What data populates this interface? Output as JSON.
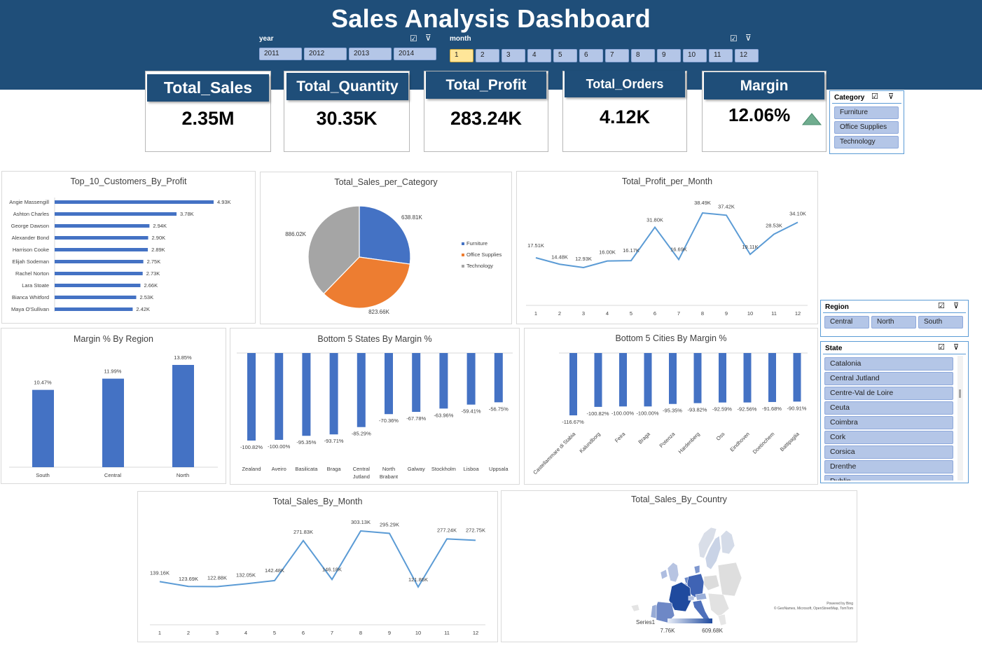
{
  "dashboard": {
    "title": "Sales Analysis Dashboard"
  },
  "slicers": {
    "year": {
      "label": "year",
      "items": [
        "2011",
        "2012",
        "2013",
        "2014"
      ]
    },
    "month": {
      "label": "month",
      "items": [
        "1",
        "2",
        "3",
        "4",
        "5",
        "6",
        "7",
        "8",
        "9",
        "10",
        "11",
        "12"
      ],
      "selected": "1"
    },
    "category": {
      "label": "Category",
      "items": [
        "Furniture",
        "Office Supplies",
        "Technology"
      ]
    },
    "region": {
      "label": "Region",
      "items": [
        "Central",
        "North",
        "South"
      ]
    },
    "state": {
      "label": "State",
      "items": [
        "Catalonia",
        "Central Jutland",
        "Centre-Val de Loire",
        "Ceuta",
        "Coimbra",
        "Cork",
        "Corsica",
        "Drenthe",
        "Dublin"
      ]
    }
  },
  "kpis": {
    "total_sales": {
      "label": "Total_Sales",
      "value": "2.35M"
    },
    "total_quantity": {
      "label": "Total_Quantity",
      "value": "30.35K"
    },
    "total_profit": {
      "label": "Total_Profit",
      "value": "283.24K"
    },
    "total_orders": {
      "label": "Total_Orders",
      "value": "4.12K"
    },
    "margin": {
      "label": "Margin",
      "value": "12.06%",
      "trend_icon": "up-triangle-icon",
      "trend_color": "#70ad8f"
    }
  },
  "colors": {
    "header": "#1f4e79",
    "bar": "#4472c4",
    "line": "#5b9bd5",
    "pie_furniture": "#4472c4",
    "pie_office": "#ed7d31",
    "pie_technology": "#a5a5a5",
    "slicer_item": "#b4c6e7",
    "slicer_selected": "#ffe699"
  },
  "map": {
    "title": "Total_Sales_By_Country",
    "legend_series": "Series1",
    "legend_min": "7.76K",
    "legend_max": "609.68K",
    "credit_line1": "Powered by Bing",
    "credit_line2": "© GeoNames, Microsoft, OpenStreetMap, TomTom"
  },
  "chart_data": [
    {
      "id": "top_customers",
      "type": "bar",
      "orientation": "horizontal",
      "title": "Top_10_Customers_By_Profit",
      "categories": [
        "Angie Massengill",
        "Ashton Charles",
        "George Dawson",
        "Alexander Bond",
        "Harrison Cooke",
        "Elijah Sodeman",
        "Rachel Norton",
        "Lara Stoate",
        "Bianca Whitford",
        "Maya O'Sullivan"
      ],
      "values": [
        4.93,
        3.78,
        2.94,
        2.9,
        2.89,
        2.75,
        2.73,
        2.66,
        2.53,
        2.42
      ],
      "labels": [
        "4.93K",
        "3.78K",
        "2.94K",
        "2.90K",
        "2.89K",
        "2.75K",
        "2.73K",
        "2.66K",
        "2.53K",
        "2.42K"
      ],
      "unit": "K"
    },
    {
      "id": "sales_per_category",
      "type": "pie",
      "title": "Total_Sales_per_Category",
      "categories": [
        "Furniture",
        "Office Supplies",
        "Technology"
      ],
      "values": [
        638.81,
        823.66,
        886.02
      ],
      "labels": [
        "638.81K",
        "823.66K",
        "886.02K"
      ],
      "legend": "right"
    },
    {
      "id": "profit_per_month",
      "type": "line",
      "title": "Total_Profit_per_Month",
      "x": [
        "1",
        "2",
        "3",
        "4",
        "5",
        "6",
        "7",
        "8",
        "9",
        "10",
        "11",
        "12"
      ],
      "values": [
        17.51,
        14.48,
        12.93,
        16.0,
        16.17,
        31.8,
        16.69,
        38.49,
        37.42,
        19.11,
        28.53,
        34.1
      ],
      "labels": [
        "17.51K",
        "14.48K",
        "12.93K",
        "16.00K",
        "16.17K",
        "31.80K",
        "16.69K",
        "38.49K",
        "37.42K",
        "19.11K",
        "28.53K",
        "34.10K"
      ]
    },
    {
      "id": "margin_by_region",
      "type": "bar",
      "title": "Margin % By Region",
      "categories": [
        "South",
        "Central",
        "North"
      ],
      "values": [
        10.47,
        11.99,
        13.85
      ],
      "labels": [
        "10.47%",
        "11.99%",
        "13.85%"
      ]
    },
    {
      "id": "bottom_states",
      "type": "bar",
      "title": "Bottom 5 States By Margin %",
      "categories": [
        "Zealand",
        "Aveiro",
        "Basilicata",
        "Braga",
        "Central Jutland",
        "North Brabant",
        "Galway",
        "Stockholm",
        "Lisboa",
        "Uppsala"
      ],
      "values": [
        -100.82,
        -100.0,
        -95.35,
        -93.71,
        -85.29,
        -70.36,
        -67.78,
        -63.96,
        -59.41,
        -56.75
      ],
      "labels": [
        "-100.82%",
        "-100.00%",
        "-95.35%",
        "-93.71%",
        "-85.29%",
        "-70.36%",
        "-67.78%",
        "-63.96%",
        "-59.41%",
        "-56.75%"
      ]
    },
    {
      "id": "bottom_cities",
      "type": "bar",
      "title": "Bottom 5 Cities By Margin %",
      "categories": [
        "Castellammare di Stabia",
        "Kalundborg",
        "Feira",
        "Braga",
        "Potenza",
        "Hardenberg",
        "Oss",
        "Eindhoven",
        "Doetinchem",
        "Battipaglia"
      ],
      "values": [
        -116.67,
        -100.82,
        -100.0,
        -100.0,
        -95.35,
        -93.82,
        -92.59,
        -92.56,
        -91.68,
        -90.91
      ],
      "labels": [
        "-116.67%",
        "-100.82%",
        "-100.00%",
        "-100.00%",
        "-95.35%",
        "-93.82%",
        "-92.59%",
        "-92.56%",
        "-91.68%",
        "-90.91%"
      ]
    },
    {
      "id": "sales_by_month",
      "type": "line",
      "title": "Total_Sales_By_Month",
      "x": [
        "1",
        "2",
        "3",
        "4",
        "5",
        "6",
        "7",
        "8",
        "9",
        "10",
        "11",
        "12"
      ],
      "values": [
        139.16,
        123.69,
        122.88,
        132.05,
        142.48,
        271.83,
        146.18,
        303.13,
        295.29,
        121.86,
        277.24,
        272.75
      ],
      "labels": [
        "139.16K",
        "123.69K",
        "122.88K",
        "132.05K",
        "142.48K",
        "271.83K",
        "146.18K",
        "303.13K",
        "295.29K",
        "121.86K",
        "277.24K",
        "272.75K"
      ]
    }
  ]
}
